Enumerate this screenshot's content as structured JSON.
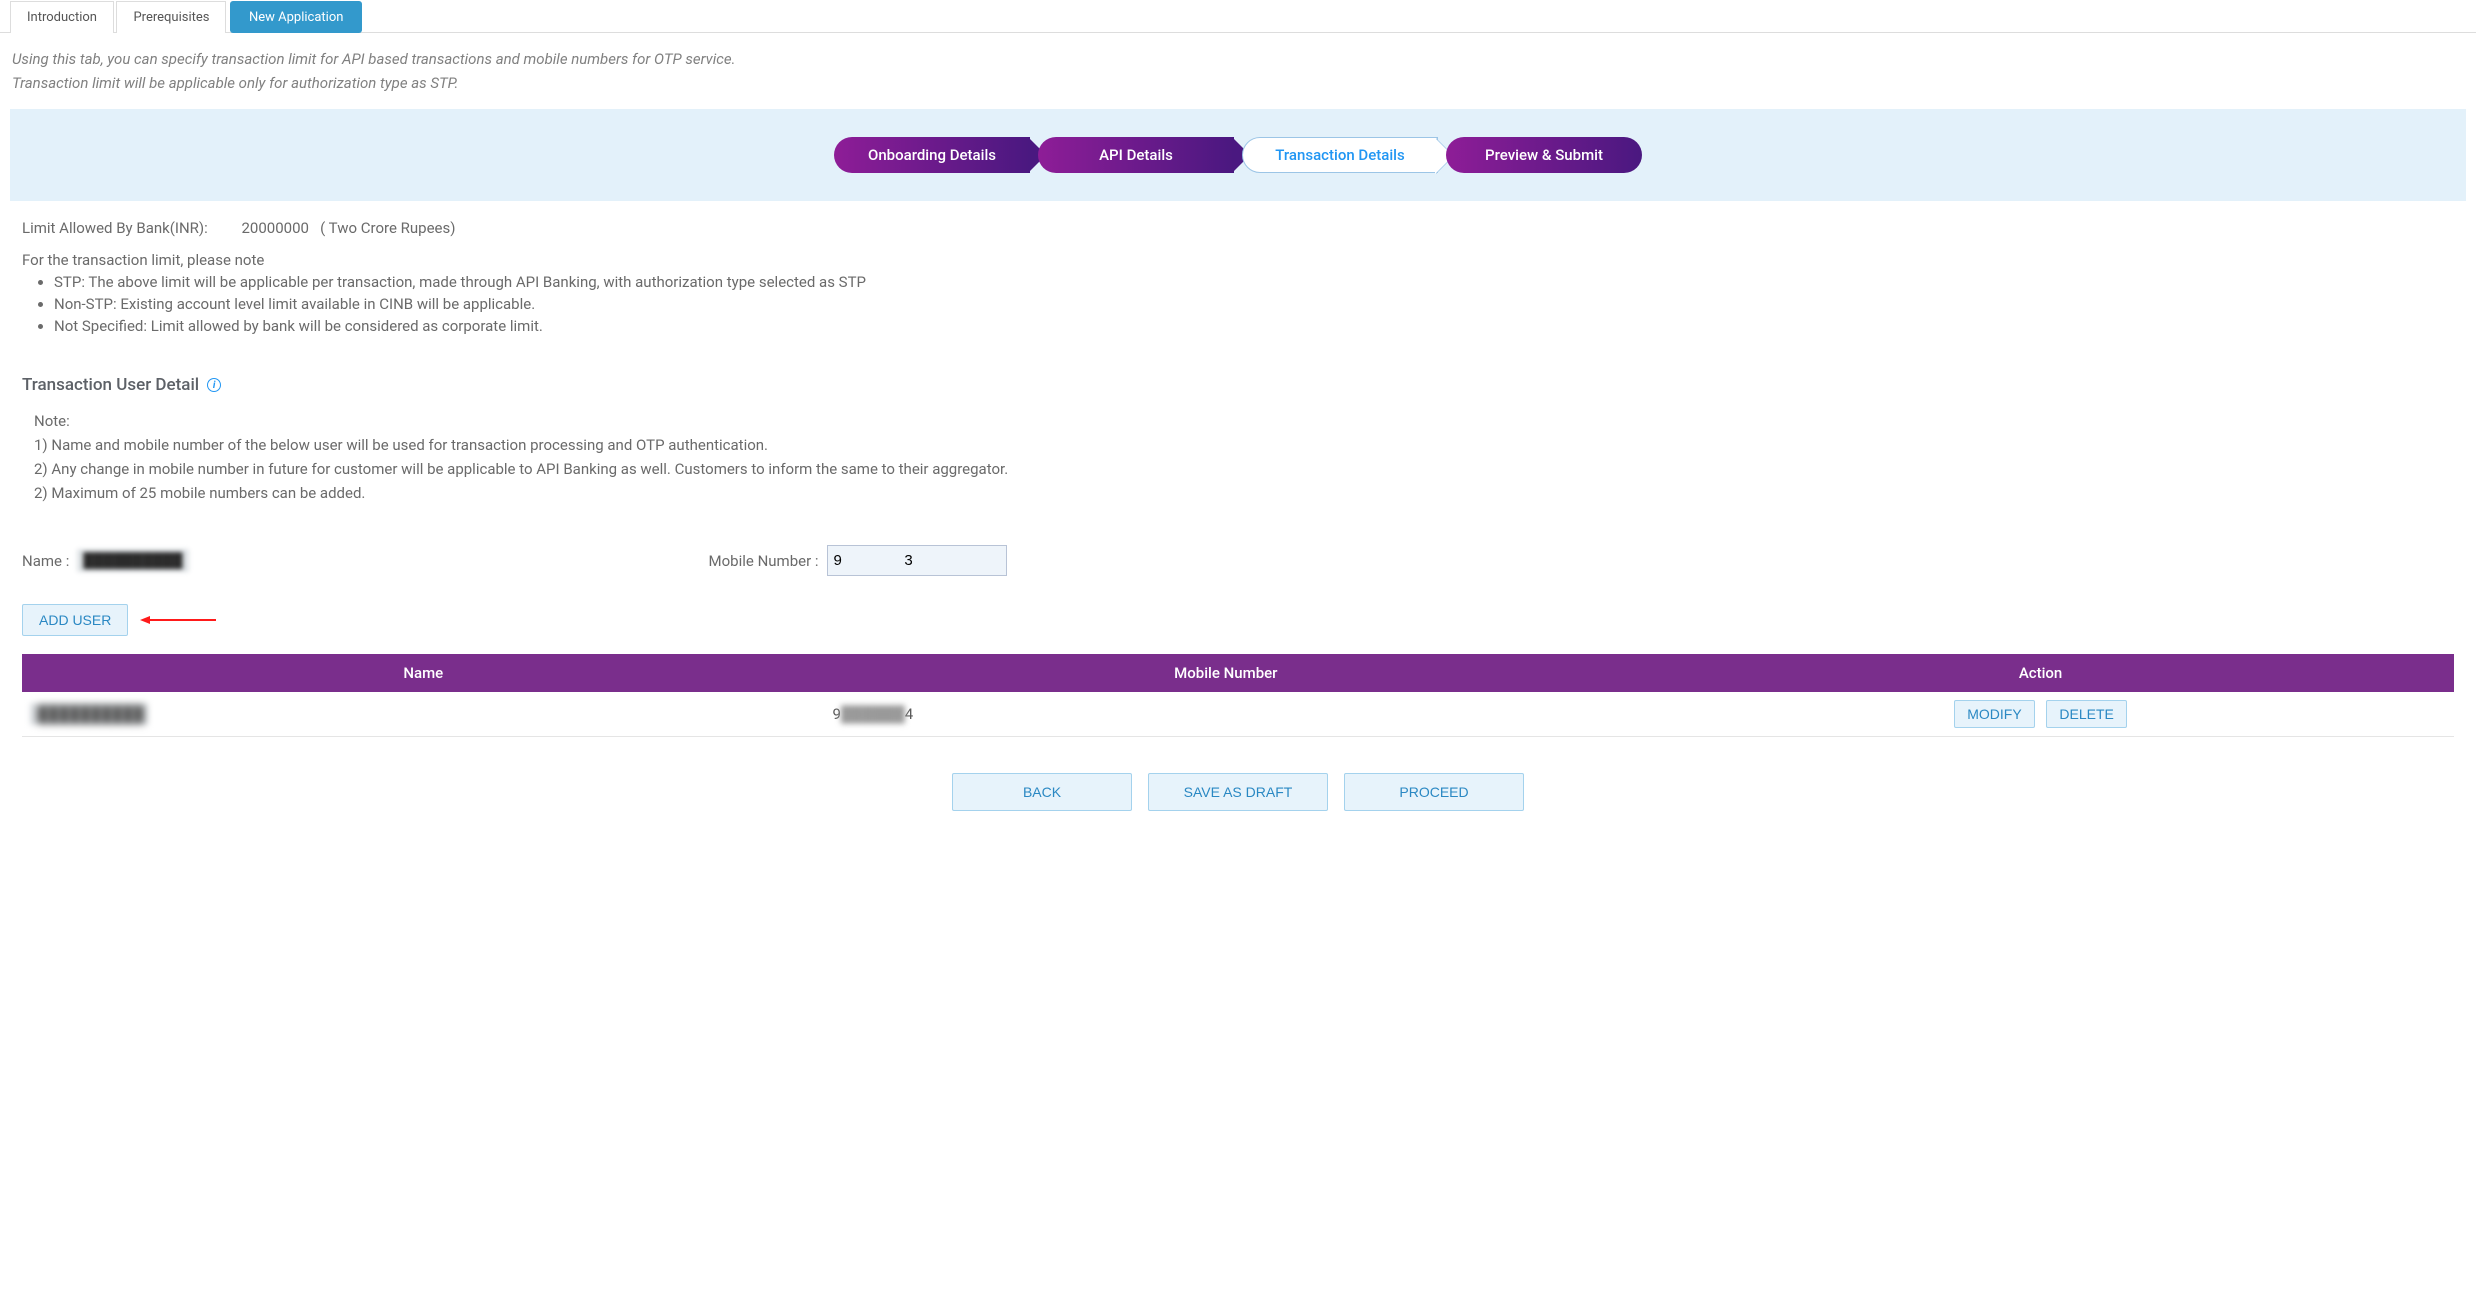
{
  "tabs": [
    {
      "label": "Introduction",
      "active": false
    },
    {
      "label": "Prerequisites",
      "active": false
    },
    {
      "label": "New Application",
      "active": true
    }
  ],
  "intro": {
    "line1": "Using this tab, you can specify transaction limit for API based transactions and mobile numbers for OTP service.",
    "line2": "Transaction limit will be applicable only for authorization type as STP."
  },
  "steps": [
    {
      "label": "Onboarding Details",
      "state": "done"
    },
    {
      "label": "API Details",
      "state": "done"
    },
    {
      "label": "Transaction Details",
      "state": "current"
    },
    {
      "label": "Preview & Submit",
      "state": "upcoming"
    }
  ],
  "limit": {
    "label": "Limit Allowed By Bank(INR):",
    "value": "20000000",
    "words": "( Two Crore Rupees)"
  },
  "limit_notes": {
    "heading": "For the transaction limit, please note",
    "items": [
      "STP: The above limit will be applicable per transaction, made through API Banking, with authorization type selected as STP",
      "Non-STP: Existing account level limit available in CINB will be applicable.",
      "Not Specified: Limit allowed by bank will be considered as corporate limit."
    ]
  },
  "section_heading": "Transaction User Detail",
  "user_notes": {
    "heading": "Note:",
    "items": [
      "1) Name and mobile number of the below user will be used for transaction processing and OTP authentication.",
      "2) Any change in mobile number in future for customer will be applicable to API Banking as well. Customers to inform the same to their aggregator.",
      "2) Maximum of 25 mobile numbers can be added."
    ]
  },
  "form": {
    "name_label": "Name :",
    "name_value": "██████████",
    "mobile_label": "Mobile Number :",
    "mobile_value": "9               3"
  },
  "add_user_btn": "ADD USER",
  "table": {
    "headers": [
      "Name",
      "Mobile Number",
      "Action"
    ],
    "row": {
      "name": ":██████████",
      "mobile_prefix": "9",
      "mobile_mid": "██████",
      "mobile_suffix": "4",
      "modify": "MODIFY",
      "delete": "DELETE"
    }
  },
  "footer": {
    "back": "BACK",
    "save": "SAVE AS DRAFT",
    "proceed": "PROCEED"
  }
}
